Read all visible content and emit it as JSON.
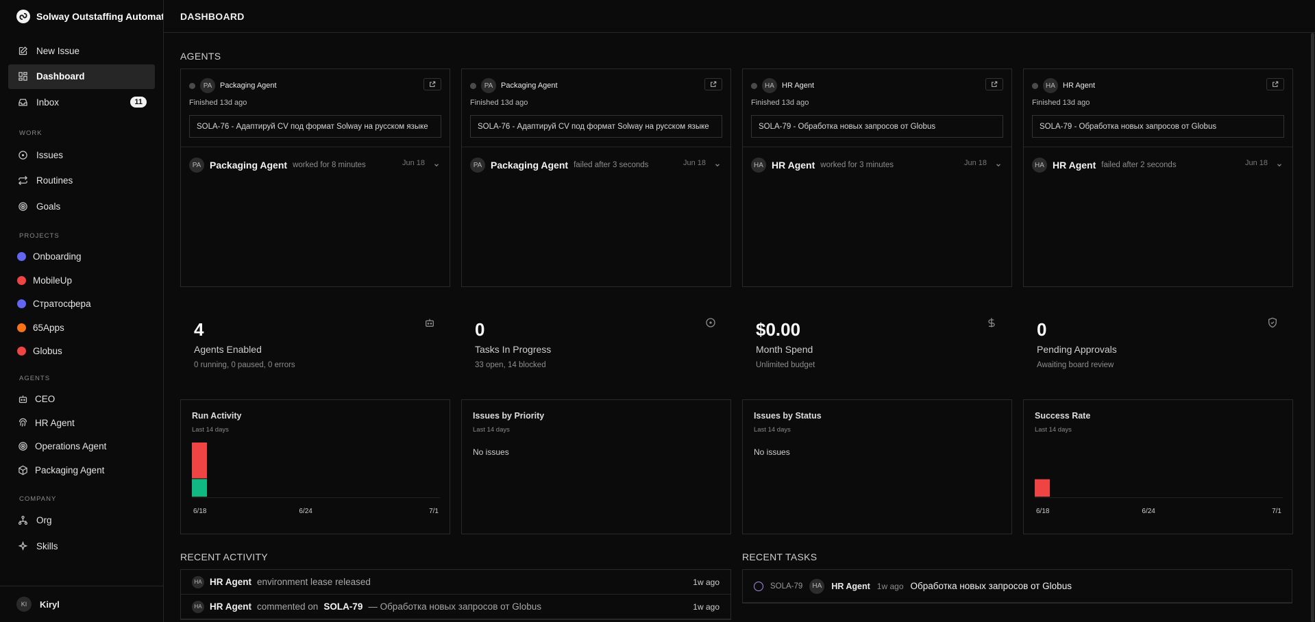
{
  "brand": {
    "name": "Solway Outstaffing Automat"
  },
  "nav": {
    "new_issue": "New Issue",
    "dashboard": "Dashboard",
    "inbox": "Inbox",
    "inbox_count": "11"
  },
  "sections": {
    "work": "WORK",
    "projects": "PROJECTS",
    "agents": "AGENTS",
    "company": "COMPANY"
  },
  "work_items": [
    {
      "label": "Issues",
      "icon": "circle-dot-icon"
    },
    {
      "label": "Routines",
      "icon": "repeat-icon"
    },
    {
      "label": "Goals",
      "icon": "target-icon"
    }
  ],
  "projects": [
    {
      "label": "Onboarding",
      "color": "#6366f1"
    },
    {
      "label": "MobileUp",
      "color": "#ef4444"
    },
    {
      "label": "Стратосфера",
      "color": "#6366f1"
    },
    {
      "label": "65Apps",
      "color": "#f97316"
    },
    {
      "label": "Globus",
      "color": "#ef4444"
    }
  ],
  "agent_nav": [
    {
      "label": "CEO",
      "icon": "bot-icon"
    },
    {
      "label": "HR Agent",
      "icon": "fingerprint-icon"
    },
    {
      "label": "Operations Agent",
      "icon": "target-icon"
    },
    {
      "label": "Packaging Agent",
      "icon": "package-icon"
    }
  ],
  "company_items": [
    {
      "label": "Org",
      "icon": "org-icon"
    },
    {
      "label": "Skills",
      "icon": "sparkle-icon"
    }
  ],
  "user": {
    "initials": "KI",
    "name": "Kiryl"
  },
  "page": {
    "title": "DASHBOARD",
    "agents_heading": "AGENTS"
  },
  "agent_cards": [
    {
      "initials": "PA",
      "name": "Packaging Agent",
      "finished": "Finished 13d ago",
      "issue": "SOLA-76 - Адаптируй CV под формат Solway на русском языке",
      "run_name": "Packaging Agent",
      "run_status": "worked for 8 minutes",
      "date": "Jun 18"
    },
    {
      "initials": "PA",
      "name": "Packaging Agent",
      "finished": "Finished 13d ago",
      "issue": "SOLA-76 - Адаптируй CV под формат Solway на русском языке",
      "run_name": "Packaging Agent",
      "run_status": "failed after 3 seconds",
      "date": "Jun 18"
    },
    {
      "initials": "HA",
      "name": "HR Agent",
      "finished": "Finished 13d ago",
      "issue": "SOLA-79 - Обработка новых запросов от Globus",
      "run_name": "HR Agent",
      "run_status": "worked for 3 minutes",
      "date": "Jun 18"
    },
    {
      "initials": "HA",
      "name": "HR Agent",
      "finished": "Finished 13d ago",
      "issue": "SOLA-79 - Обработка новых запросов от Globus",
      "run_name": "HR Agent",
      "run_status": "failed after 2 seconds",
      "date": "Jun 18"
    }
  ],
  "stats": [
    {
      "value": "4",
      "label": "Agents Enabled",
      "sub": "0 running, 0 paused, 0 errors",
      "icon": "bot-icon"
    },
    {
      "value": "0",
      "label": "Tasks In Progress",
      "sub": "33 open, 14 blocked",
      "icon": "circle-dot-icon"
    },
    {
      "value": "$0.00",
      "label": "Month Spend",
      "sub": "Unlimited budget",
      "icon": "dollar-icon"
    },
    {
      "value": "0",
      "label": "Pending Approvals",
      "sub": "Awaiting board review",
      "icon": "shield-check-icon"
    }
  ],
  "charts": {
    "run_activity": {
      "title": "Run Activity",
      "sub": "Last 14 days",
      "ticks": [
        "6/18",
        "6/24",
        "7/1"
      ]
    },
    "issues_priority": {
      "title": "Issues by Priority",
      "sub": "Last 14 days",
      "empty": "No issues"
    },
    "issues_status": {
      "title": "Issues by Status",
      "sub": "Last 14 days",
      "empty": "No issues"
    },
    "success_rate": {
      "title": "Success Rate",
      "sub": "Last 14 days",
      "ticks": [
        "6/18",
        "6/24",
        "7/1"
      ]
    }
  },
  "chart_data": [
    {
      "type": "bar",
      "title": "Run Activity",
      "categories": [
        "6/18",
        "6/19",
        "6/20",
        "6/21",
        "6/22",
        "6/23",
        "6/24",
        "6/25",
        "6/26",
        "6/27",
        "6/28",
        "6/29",
        "6/30",
        "7/1"
      ],
      "series": [
        {
          "name": "succeeded",
          "color": "#10b981",
          "values": [
            1,
            0,
            0,
            0,
            0,
            0,
            0,
            0,
            0,
            0,
            0,
            0,
            0,
            0
          ]
        },
        {
          "name": "failed",
          "color": "#ef4444",
          "values": [
            2,
            0,
            0,
            0,
            0,
            0,
            0,
            0,
            0,
            0,
            0,
            0,
            0,
            0
          ]
        }
      ],
      "ylim": [
        0,
        3
      ]
    },
    {
      "type": "bar",
      "title": "Success Rate",
      "categories": [
        "6/18",
        "6/19",
        "6/20",
        "6/21",
        "6/22",
        "6/23",
        "6/24",
        "6/25",
        "6/26",
        "6/27",
        "6/28",
        "6/29",
        "6/30",
        "7/1"
      ],
      "values": [
        0.33,
        0,
        0,
        0,
        0,
        0,
        0,
        0,
        0,
        0,
        0,
        0,
        0,
        0
      ],
      "color": "#ef4444",
      "ylim": [
        0,
        1
      ]
    }
  ],
  "recent_activity": {
    "title": "RECENT ACTIVITY",
    "items": [
      {
        "initials": "HA",
        "actor": "HR Agent",
        "verb": "environment lease released",
        "target": "",
        "rest": "",
        "time": "1w ago"
      },
      {
        "initials": "HA",
        "actor": "HR Agent",
        "verb": "commented on",
        "target": "SOLA-79",
        "rest": "— Обработка новых запросов от Globus",
        "time": "1w ago"
      }
    ]
  },
  "recent_tasks": {
    "title": "RECENT TASKS",
    "items": [
      {
        "id": "SOLA-79",
        "initials": "HA",
        "agent": "HR Agent",
        "time": "1w ago",
        "title": "Обработка новых запросов от Globus"
      }
    ]
  }
}
